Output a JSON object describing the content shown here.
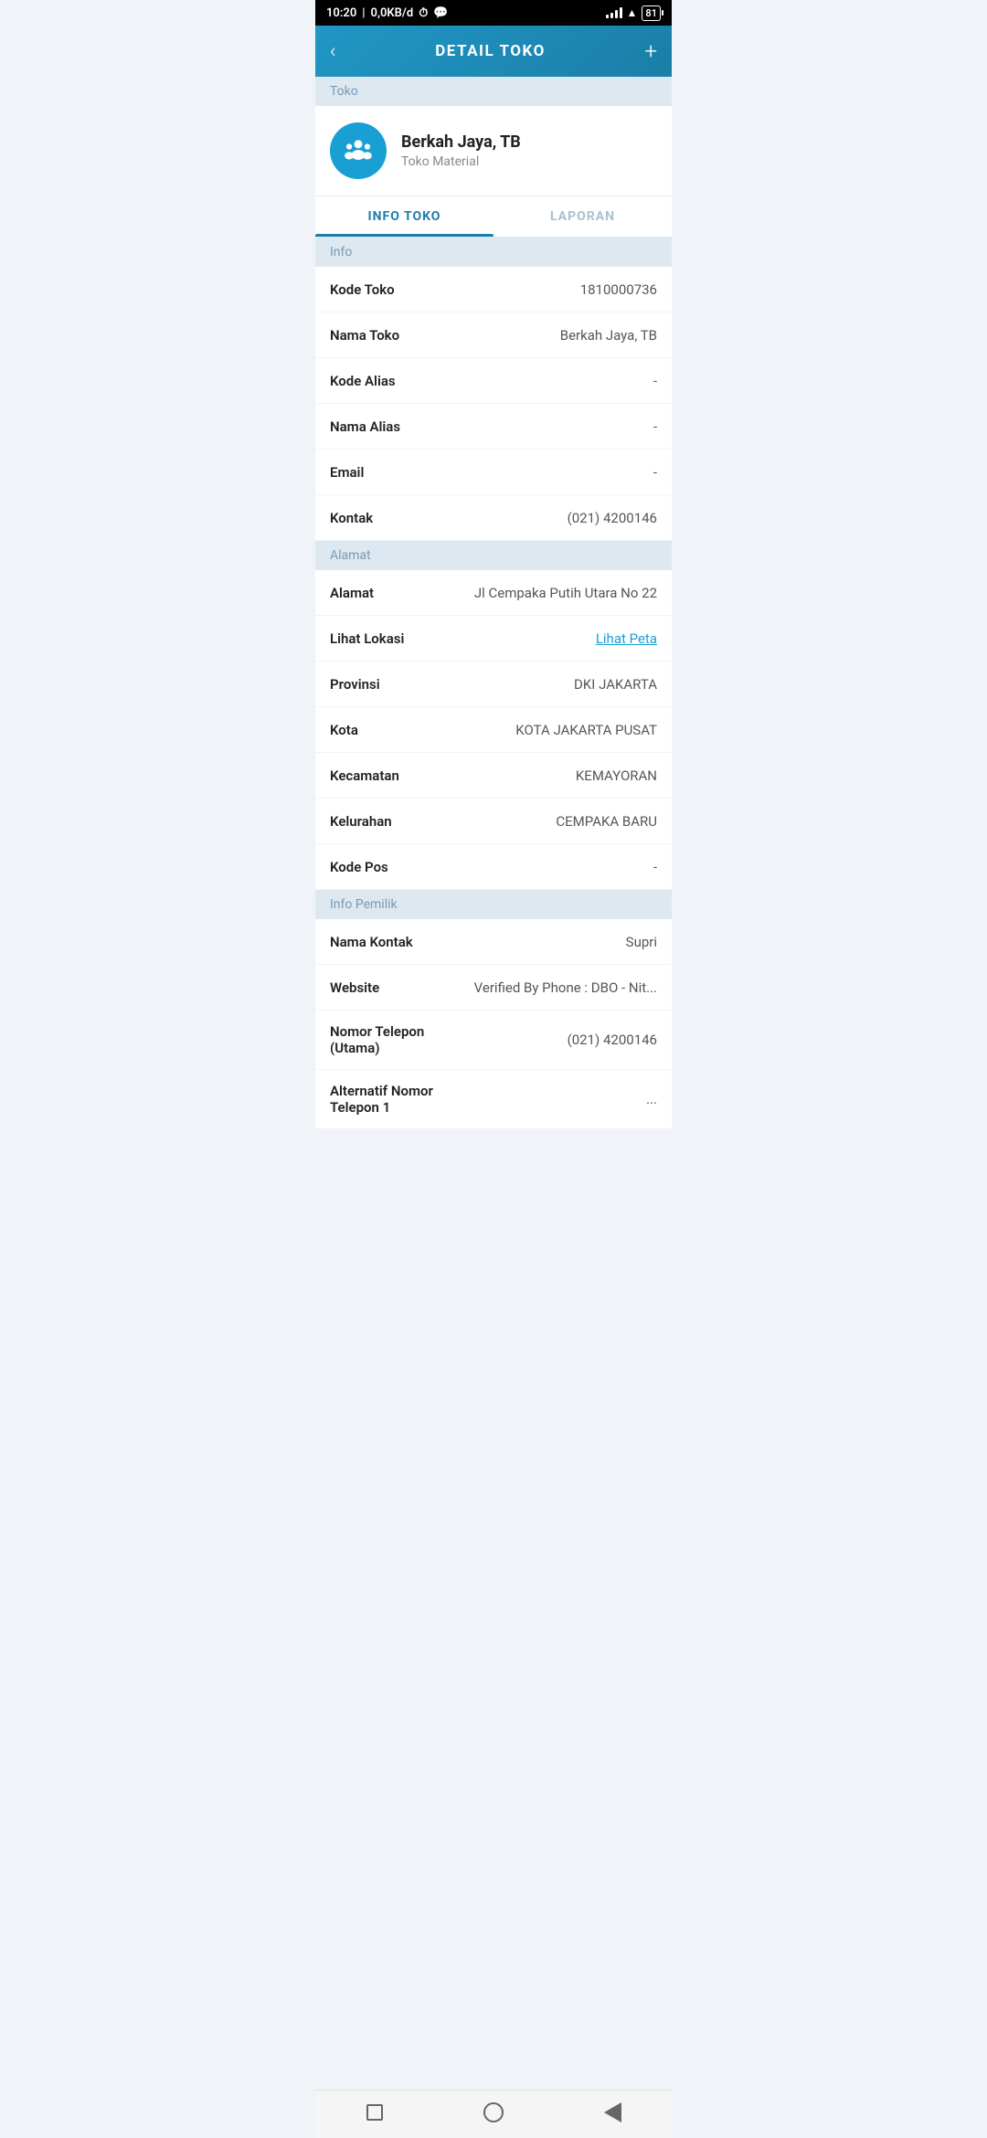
{
  "statusBar": {
    "time": "10:20",
    "network": "0,0KB/d",
    "battery": "81"
  },
  "header": {
    "title": "DETAIL TOKO",
    "backLabel": "‹",
    "addLabel": "+"
  },
  "storeSectionLabel": "Toko",
  "store": {
    "name": "Berkah Jaya, TB",
    "type": "Toko Material"
  },
  "tabs": [
    {
      "id": "info",
      "label": "INFO TOKO",
      "active": true
    },
    {
      "id": "laporan",
      "label": "LAPORAN",
      "active": false
    }
  ],
  "infoSection": {
    "label": "Info",
    "rows": [
      {
        "label": "Kode Toko",
        "value": "1810000736",
        "link": false
      },
      {
        "label": "Nama Toko",
        "value": "Berkah Jaya, TB",
        "link": false
      },
      {
        "label": "Kode Alias",
        "value": "-",
        "link": false
      },
      {
        "label": "Nama Alias",
        "value": "-",
        "link": false
      },
      {
        "label": "Email",
        "value": "-",
        "link": false
      },
      {
        "label": "Kontak",
        "value": "(021) 4200146",
        "link": false
      }
    ]
  },
  "alamatSection": {
    "label": "Alamat",
    "rows": [
      {
        "label": "Alamat",
        "value": "Jl Cempaka Putih Utara No 22",
        "link": false
      },
      {
        "label": "Lihat Lokasi",
        "value": "Lihat Peta",
        "link": true
      },
      {
        "label": "Provinsi",
        "value": "DKI JAKARTA",
        "link": false
      },
      {
        "label": "Kota",
        "value": "KOTA JAKARTA PUSAT",
        "link": false
      },
      {
        "label": "Kecamatan",
        "value": "KEMAYORAN",
        "link": false
      },
      {
        "label": "Kelurahan",
        "value": "CEMPAKA BARU",
        "link": false
      },
      {
        "label": "Kode Pos",
        "value": "-",
        "link": false
      }
    ]
  },
  "infoPemilikSection": {
    "label": "Info Pemilik",
    "rows": [
      {
        "label": "Nama Kontak",
        "value": "Supri",
        "link": false
      },
      {
        "label": "Website",
        "value": "Verified By Phone : DBO - Nit...",
        "link": false
      },
      {
        "label": "Nomor Telepon (Utama)",
        "value": "(021) 4200146",
        "link": false
      },
      {
        "label": "Alternatif Nomor Telepon 1",
        "value": "...",
        "link": false
      }
    ]
  }
}
